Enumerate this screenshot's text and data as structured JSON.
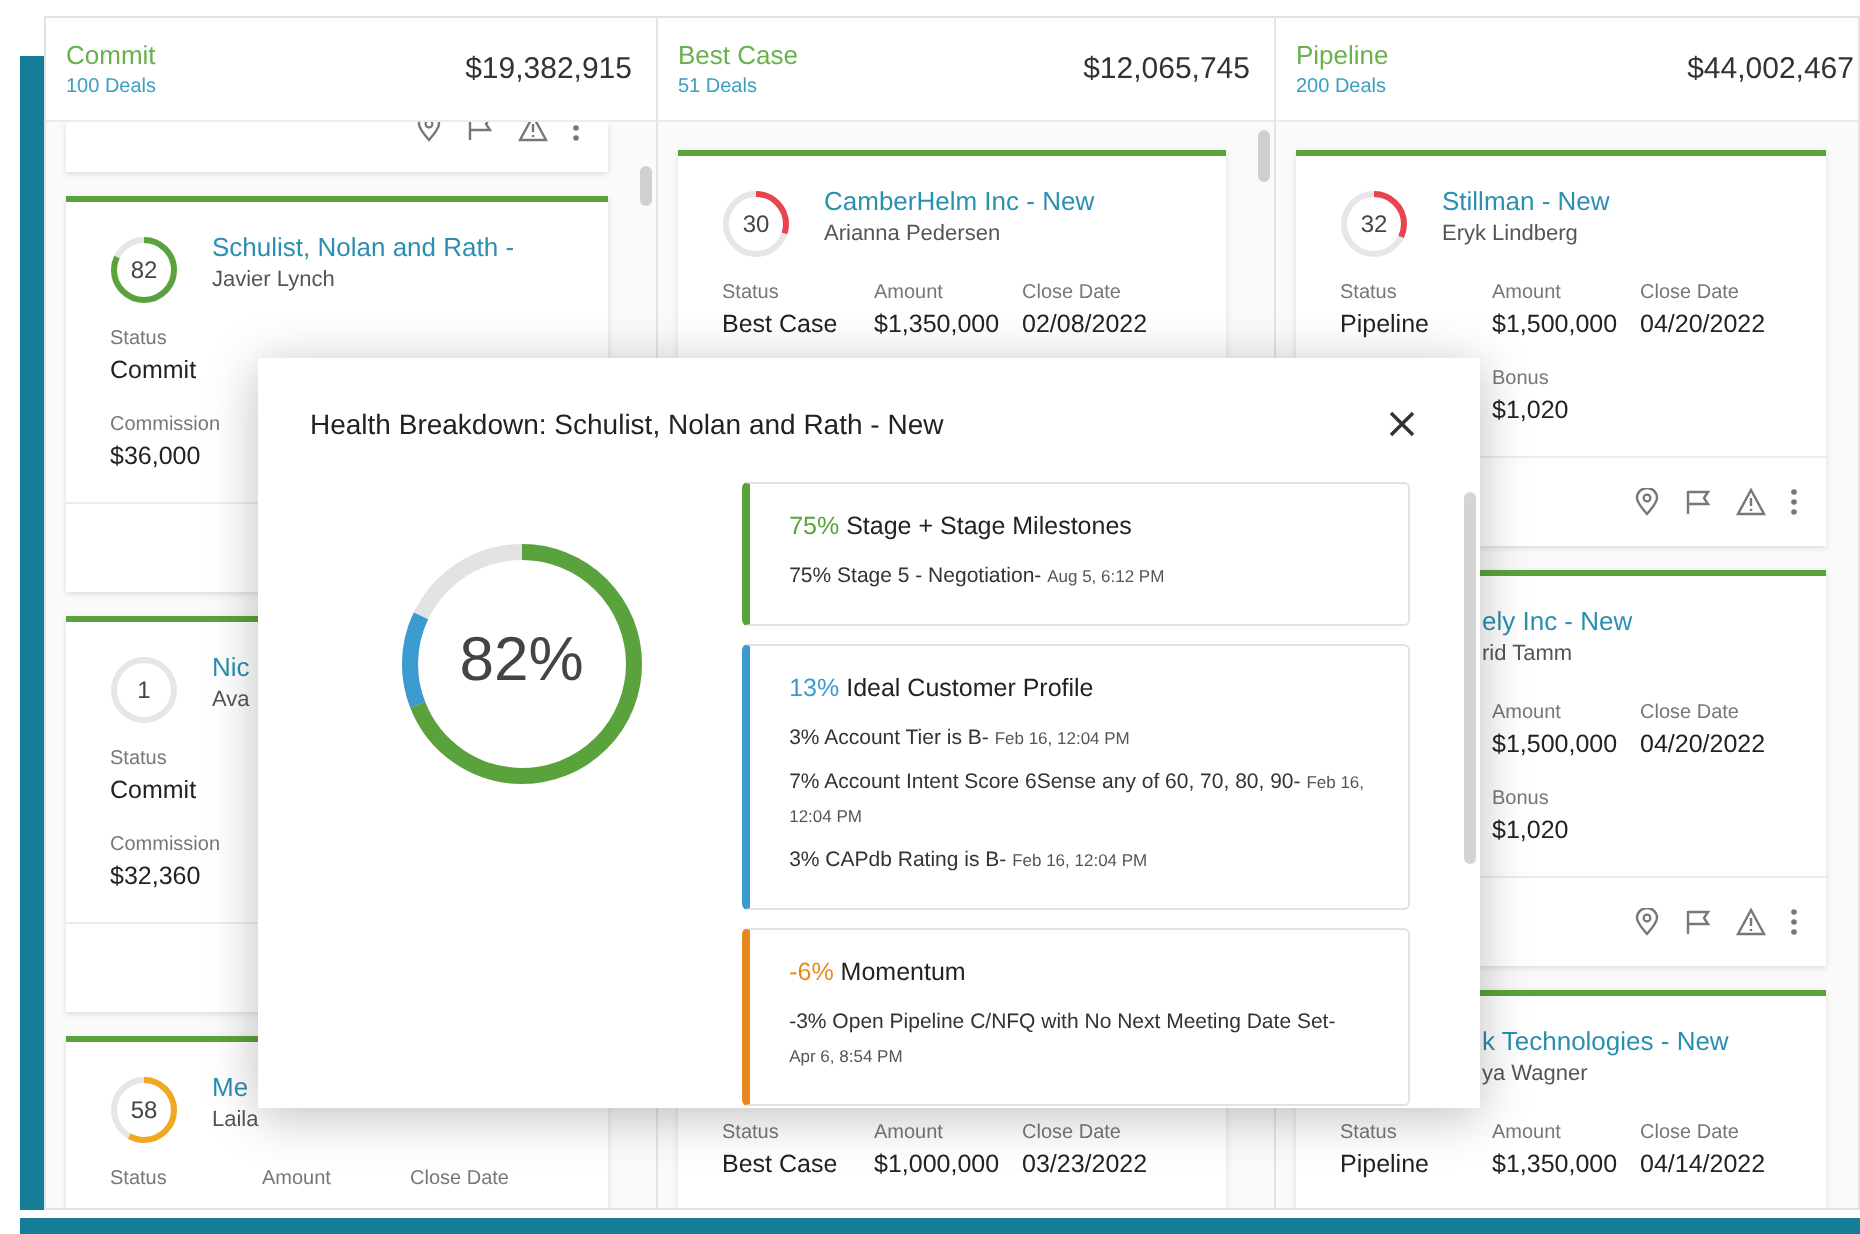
{
  "columns": [
    {
      "title": "Commit",
      "deals": "100 Deals",
      "total": "$19,382,915",
      "cards": [
        {
          "kind": "footer",
          "actions": true
        },
        {
          "kind": "deal",
          "score": "82",
          "color": "#5aa33c",
          "title": "Schulist, Nolan and Rath -",
          "owner": "Javier Lynch",
          "fields": {
            "status": {
              "label": "Status",
              "value": "Commit"
            },
            "commission": {
              "label": "Commission",
              "value": "$36,000"
            }
          }
        },
        {
          "kind": "deal",
          "score": "1",
          "title": "Nic",
          "owner": "Ava",
          "fields": {
            "status": {
              "label": "Status",
              "value": "Commit"
            },
            "commission": {
              "label": "Commission",
              "value": "$32,360"
            }
          }
        },
        {
          "kind": "deal",
          "score": "58",
          "color": "#f0a81e",
          "title": "Me",
          "owner": "Laila",
          "fields": {
            "status": {
              "label": "Status"
            },
            "amount": {
              "label": "Amount"
            },
            "close_date": {
              "label": "Close Date"
            }
          }
        }
      ]
    },
    {
      "title": "Best Case",
      "deals": "51 Deals",
      "total": "$12,065,745",
      "cards": [
        {
          "kind": "deal",
          "score": "30",
          "color": "#e8434f",
          "title": "CamberHelm Inc - New",
          "owner": "Arianna Pedersen",
          "fields": {
            "status": {
              "label": "Status",
              "value": "Best Case"
            },
            "amount": {
              "label": "Amount",
              "value": "$1,350,000"
            },
            "close_date": {
              "label": "Close Date",
              "value": "02/08/2022"
            }
          }
        },
        {
          "kind": "deal",
          "fields": {
            "status": {
              "label": "Status",
              "value": "Best Case"
            },
            "amount": {
              "label": "Amount",
              "value": "$1,000,000"
            },
            "close_date": {
              "label": "Close Date",
              "value": "03/23/2022"
            }
          }
        }
      ]
    },
    {
      "title": "Pipeline",
      "deals": "200 Deals",
      "total": "$44,002,467",
      "cards": [
        {
          "kind": "deal",
          "score": "32",
          "color": "#e8434f",
          "title": "Stillman - New",
          "owner": "Eryk Lindberg",
          "fields": {
            "status": {
              "label": "Status",
              "value": "Pipeline"
            },
            "amount": {
              "label": "Amount",
              "value": "$1,500,000"
            },
            "close_date": {
              "label": "Close Date",
              "value": "04/20/2022"
            },
            "bonus": {
              "label": "Bonus",
              "value": "$1,020"
            }
          },
          "actions": true
        },
        {
          "kind": "deal",
          "title": "ely Inc - New",
          "owner": "rid Tamm",
          "fields": {
            "amount": {
              "label": "Amount",
              "value": "$1,500,000"
            },
            "close_date": {
              "label": "Close Date",
              "value": "04/20/2022"
            },
            "bonus": {
              "label": "Bonus",
              "value": "$1,020"
            }
          },
          "actions": true
        },
        {
          "kind": "deal",
          "title": "k Technologies - New",
          "owner": "ya Wagner",
          "fields": {
            "status": {
              "label": "Status",
              "value": "Pipeline"
            },
            "amount": {
              "label": "Amount",
              "value": "$1,350,000"
            },
            "close_date": {
              "label": "Close Date",
              "value": "04/14/2022"
            }
          }
        }
      ]
    }
  ],
  "dialog": {
    "title": "Health Breakdown: Schulist, Nolan and Rath - New",
    "score": "82%",
    "segments": [
      {
        "level": 0.69,
        "color": "#5aa33c"
      },
      {
        "level": 0.13,
        "color": "#3b9ad0"
      }
    ],
    "items": [
      {
        "percent": "75%",
        "title": "Stage + Stage Milestones",
        "color": "#5aa33c",
        "lines": [
          {
            "text": "75% Stage 5 - Negotiation-",
            "time": "Aug 5, 6:12 PM"
          }
        ]
      },
      {
        "percent": "13%",
        "title": "Ideal Customer Profile",
        "color": "#3b9ad0",
        "lines": [
          {
            "text": "3% Account Tier is B-",
            "time": "Feb 16, 12:04 PM"
          },
          {
            "text": "7% Account Intent Score 6Sense any of 60, 70, 80, 90-",
            "time": "Feb 16, 12:04 PM"
          },
          {
            "text": "3% CAPdb Rating is B-",
            "time": "Feb 16, 12:04 PM"
          }
        ]
      },
      {
        "percent": "-6%",
        "title": "Momentum",
        "color": "#e8891e",
        "lines": [
          {
            "text": "-3% Open Pipeline C/NFQ with No Next Meeting Date Set-",
            "time": "Apr 6, 8:54 PM"
          }
        ]
      }
    ]
  }
}
